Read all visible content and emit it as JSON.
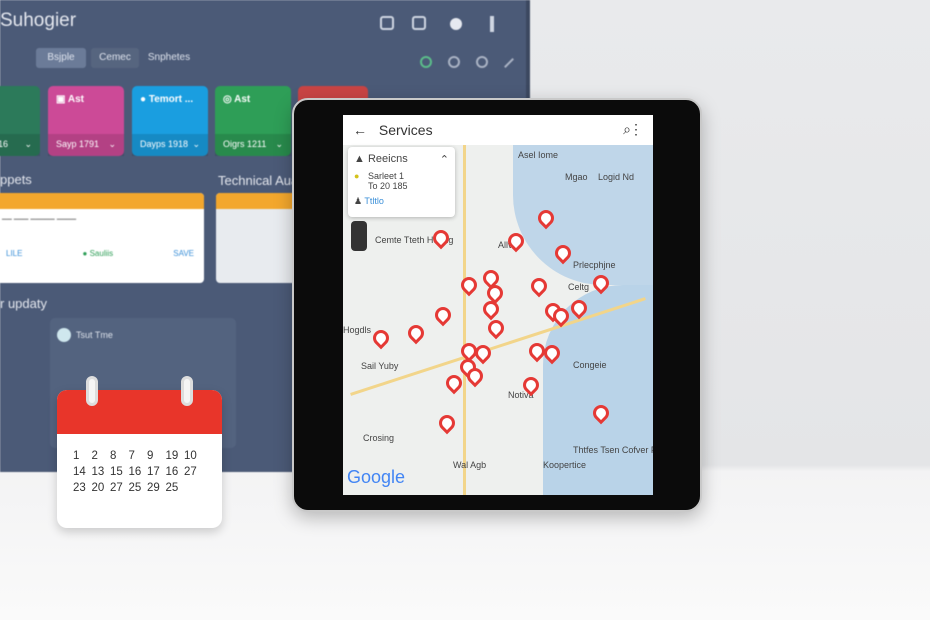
{
  "monitor": {
    "app_title": "Suhogier",
    "tabs": [
      "Bsjple",
      "Cemec",
      "Snphetes"
    ],
    "cards": [
      {
        "title": "",
        "footer": "16",
        "color": "#2c7a5a"
      },
      {
        "title": "Ast",
        "footer": "Sayp 1791",
        "color": "#cc4a97"
      },
      {
        "title": "Temort ...",
        "footer": "Dayps 1918",
        "color": "#1a9ee0"
      },
      {
        "title": "Ast",
        "footer": "Oigrs 1211",
        "color": "#2e9e57"
      }
    ],
    "section_reports": "ppets",
    "section_technical": "Technical Aual",
    "section_updates": "r updaty",
    "update_card_title": "Tsut Tme",
    "panel_left_footer": [
      "LILE",
      "Sauliis",
      "SAVE"
    ]
  },
  "map_app": {
    "title": "Services",
    "info_panel": {
      "title": "Reeicns",
      "line1": "Sarleet 1",
      "line2": "To 20 185",
      "link": "Ttltlo"
    },
    "labels": [
      "Asel Iome",
      "Logid Nd",
      "Mgao",
      "Cemte Tteth Hoong",
      "Allvis",
      "Prlecphjne",
      "Celtg",
      "Hogdls",
      "Sail Yuby",
      "Congeie",
      "Notiva",
      "Crosing",
      "Wal Agb",
      "Koopertice",
      "Thtfes Tsen Cofver Faee"
    ],
    "logo": "Google",
    "accent": "#e53935"
  },
  "calendar": {
    "days": [
      "1",
      "2",
      "8",
      "7",
      "9",
      "19",
      "10",
      "14",
      "13",
      "15",
      "16",
      "17",
      "16",
      "27",
      "23",
      "20",
      "27",
      "25",
      "29",
      "25"
    ]
  }
}
